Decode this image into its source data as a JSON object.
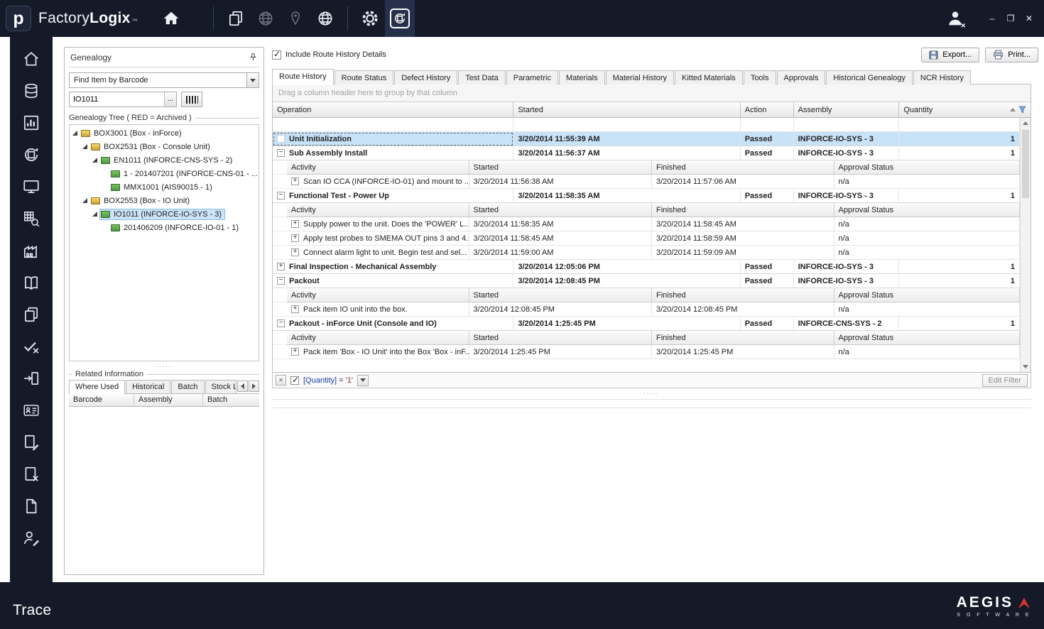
{
  "titlebar": {
    "logo_letter": "p",
    "brand_first": "Factory",
    "brand_second": "Logix",
    "trademark": "™",
    "toolbar_icons": [
      "documents",
      "network-globe",
      "location-pin",
      "web-globe",
      "settings-gear",
      "trace"
    ]
  },
  "window_controls": {
    "minimize": "–",
    "maximize": "❐",
    "close": "✕"
  },
  "sidebar": {
    "icons": [
      "home",
      "production",
      "reports",
      "trace",
      "station-monitor",
      "data-query",
      "factory",
      "library",
      "documents",
      "quality-check",
      "receiving",
      "badge",
      "work-instructions",
      "document-cancel",
      "document",
      "operator-signoff"
    ]
  },
  "genealogy": {
    "panel_title": "Genealogy",
    "search_mode": "Find Item by Barcode",
    "barcode_value": "IO1011",
    "ellipsis_label": "...",
    "tree_group_label": "Genealogy Tree ( RED = Archived )",
    "tree": [
      {
        "label": "BOX3001 (Box - inForce)"
      },
      {
        "label": "BOX2531 (Box - Console Unit)"
      },
      {
        "label": "EN1011 (INFORCE-CNS-SYS - 2)"
      },
      {
        "label": "1 - 201407201 (INFORCE-CNS-01 - ..."
      },
      {
        "label": "MMX1001 (AIS90015 - 1)"
      },
      {
        "label": "BOX2553 (Box - IO Unit)"
      },
      {
        "label": "IO1011 (INFORCE-IO-SYS - 3)"
      },
      {
        "label": "201406209 (INFORCE-IO-01 - 1)"
      }
    ],
    "splitter_dots": ".....",
    "related": {
      "group_label": "Related Information",
      "tabs": [
        "Where Used",
        "Historical",
        "Batch",
        "Stock Lo"
      ],
      "columns": [
        "Barcode",
        "Assembly",
        "Batch"
      ]
    }
  },
  "main": {
    "include_details_label": "Include Route History Details",
    "export_label": "Export...",
    "print_label": "Print...",
    "tabs": [
      "Route History",
      "Route Status",
      "Defect History",
      "Test Data",
      "Parametric",
      "Materials",
      "Material History",
      "Kitted Materials",
      "Tools",
      "Approvals",
      "Historical Genealogy",
      "NCR History"
    ],
    "group_hint": "Drag a column header here to group by that column",
    "columns": [
      "Operation",
      "Started",
      "Action",
      "Assembly",
      "Quantity"
    ],
    "sub_columns": [
      "Activity",
      "Started",
      "Finished",
      "Approval Status"
    ],
    "operations": [
      {
        "op": "Unit Initialization",
        "started": "3/20/2014 11:55:39 AM",
        "action": "Passed",
        "assembly": "INFORCE-IO-SYS - 3",
        "quantity": "1"
      },
      {
        "op": "Sub Assembly Install",
        "started": "3/20/2014 11:56:37 AM",
        "action": "Passed",
        "assembly": "INFORCE-IO-SYS - 3",
        "quantity": "1",
        "activities": [
          {
            "activity": "Scan IO CCA (INFORCE-IO-01) and mount to ...",
            "started": "3/20/2014 11:56:38 AM",
            "finished": "3/20/2014 11:57:06 AM",
            "approval": "n/a"
          }
        ]
      },
      {
        "op": "Functional Test - Power Up",
        "started": "3/20/2014 11:58:35 AM",
        "action": "Passed",
        "assembly": "INFORCE-IO-SYS - 3",
        "quantity": "1",
        "activities": [
          {
            "activity": "Supply power to the unit.  Does the 'POWER' L...",
            "started": "3/20/2014 11:58:35 AM",
            "finished": "3/20/2014 11:58:45 AM",
            "approval": "n/a"
          },
          {
            "activity": "Apply test probes to SMEMA OUT pins 3 and 4.",
            "started": "3/20/2014 11:58:45 AM",
            "finished": "3/20/2014 11:58:59 AM",
            "approval": "n/a"
          },
          {
            "activity": "Connect alarm light to unit.  Begin test and sel...",
            "started": "3/20/2014 11:59:00 AM",
            "finished": "3/20/2014 11:59:09 AM",
            "approval": "n/a"
          }
        ]
      },
      {
        "op": "Final Inspection - Mechanical Assembly",
        "started": "3/20/2014 12:05:06 PM",
        "action": "Passed",
        "assembly": "INFORCE-IO-SYS - 3",
        "quantity": "1"
      },
      {
        "op": "Packout",
        "started": "3/20/2014 12:08:45 PM",
        "action": "Passed",
        "assembly": "INFORCE-IO-SYS - 3",
        "quantity": "1",
        "activities": [
          {
            "activity": "Pack item IO unit into the box.",
            "started": "3/20/2014 12:08:45 PM",
            "finished": "3/20/2014 12:08:45 PM",
            "approval": "n/a"
          }
        ]
      },
      {
        "op": "Packout - inForce Unit (Console and IO)",
        "started": "3/20/2014 1:25:45 PM",
        "action": "Passed",
        "assembly": "INFORCE-CNS-SYS - 2",
        "quantity": "1",
        "activities": [
          {
            "activity": "Pack item 'Box - IO Unit' into the Box 'Box - inF...",
            "started": "3/20/2014 1:25:45 PM",
            "finished": "3/20/2014 1:25:45 PM",
            "approval": "n/a"
          }
        ]
      }
    ],
    "filter_bar": {
      "expression_field": "[Quantity]",
      "expression_op": "=",
      "expression_value": "'1'",
      "edit_filter_label": "Edit Filter"
    },
    "splitter_dots": "....."
  },
  "statusbar": {
    "module_title": "Trace",
    "brand_name": "AEGIS",
    "brand_subtitle": "S O F T W A R E"
  }
}
